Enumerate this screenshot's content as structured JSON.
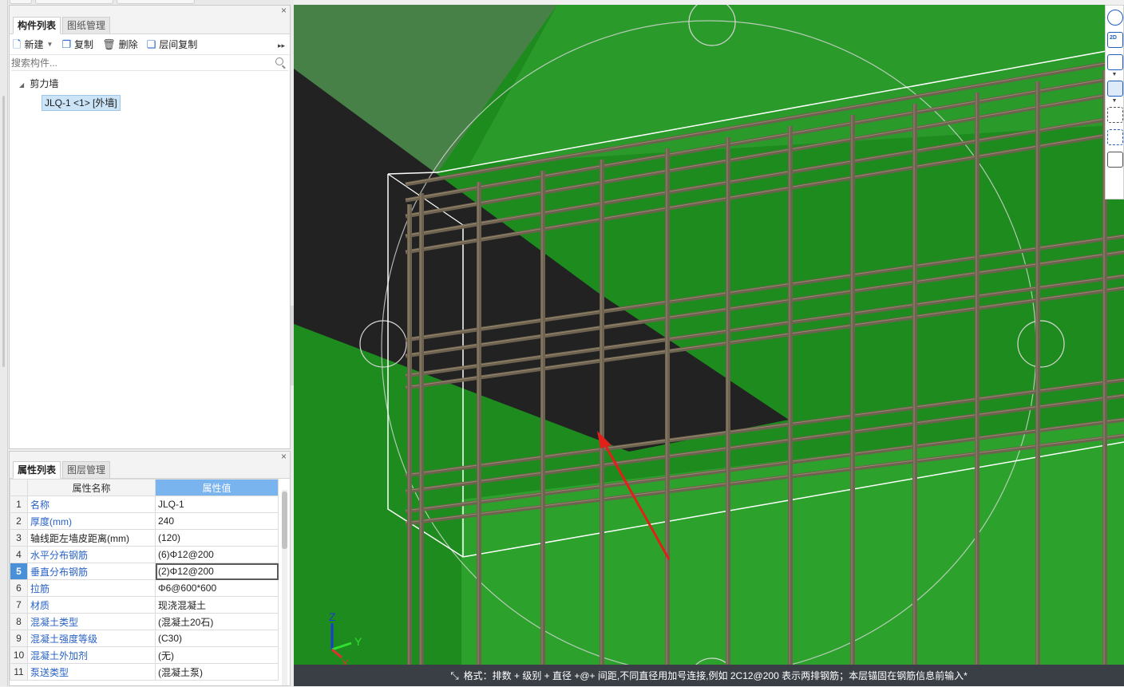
{
  "component_panel": {
    "tabs": [
      "构件列表",
      "图纸管理"
    ],
    "close": "×",
    "toolbar": {
      "new": "新建",
      "copy": "复制",
      "delete": "删除",
      "floor_copy": "层间复制",
      "more": "▸▸"
    },
    "search_placeholder": "搜索构件...",
    "tree": {
      "category": "剪力墙",
      "item": "JLQ-1 <1> [外墙]"
    }
  },
  "property_panel": {
    "tabs": [
      "属性列表",
      "图层管理"
    ],
    "close": "×",
    "headers": {
      "name": "属性名称",
      "value": "属性值"
    },
    "rows": [
      {
        "index": "1",
        "name": "名称",
        "value": "JLQ-1",
        "link": true
      },
      {
        "index": "2",
        "name": "厚度(mm)",
        "value": "240",
        "link": true
      },
      {
        "index": "3",
        "name": "轴线距左墙皮距离(mm)",
        "value": "(120)",
        "link": false
      },
      {
        "index": "4",
        "name": "水平分布钢筋",
        "value": "(6)Φ12@200",
        "link": true
      },
      {
        "index": "5",
        "name": "垂直分布钢筋",
        "value": "(2)Φ12@200",
        "link": true,
        "selected": true
      },
      {
        "index": "6",
        "name": "拉筋",
        "value": "Φ6@600*600",
        "link": true
      },
      {
        "index": "7",
        "name": "材质",
        "value": "现浇混凝土",
        "link": true
      },
      {
        "index": "8",
        "name": "混凝土类型",
        "value": "(混凝土20石)",
        "link": true
      },
      {
        "index": "9",
        "name": "混凝土强度等级",
        "value": "(C30)",
        "link": true
      },
      {
        "index": "10",
        "name": "混凝土外加剂",
        "value": "(无)",
        "link": true
      },
      {
        "index": "11",
        "name": "泵送类型",
        "value": "(混凝土泵)",
        "link": true
      }
    ]
  },
  "viewport": {
    "axis_labels": {
      "z": "Z",
      "y": "Y",
      "x": "X"
    },
    "colors": {
      "floor_green": "#1e8b1e",
      "wall_gray": "#5b5b5b",
      "rebar": "#6e6250",
      "arrow": "#e0201a"
    },
    "tools": [
      "orbit-icon",
      "2d-view-icon",
      "box-view-icon",
      "solid-view-icon",
      "selection-box-icon",
      "cube-select-icon",
      "list-view-icon"
    ],
    "tool_2d_label": "2D"
  },
  "status": {
    "icon": "shrink-arrows-icon",
    "text": "格式：排数 + 级别 + 直径 +@+ 间距,不同直径用加号连接,例如 2C12@200 表示两排钢筋；本层锚固在钢筋信息前输入*"
  }
}
